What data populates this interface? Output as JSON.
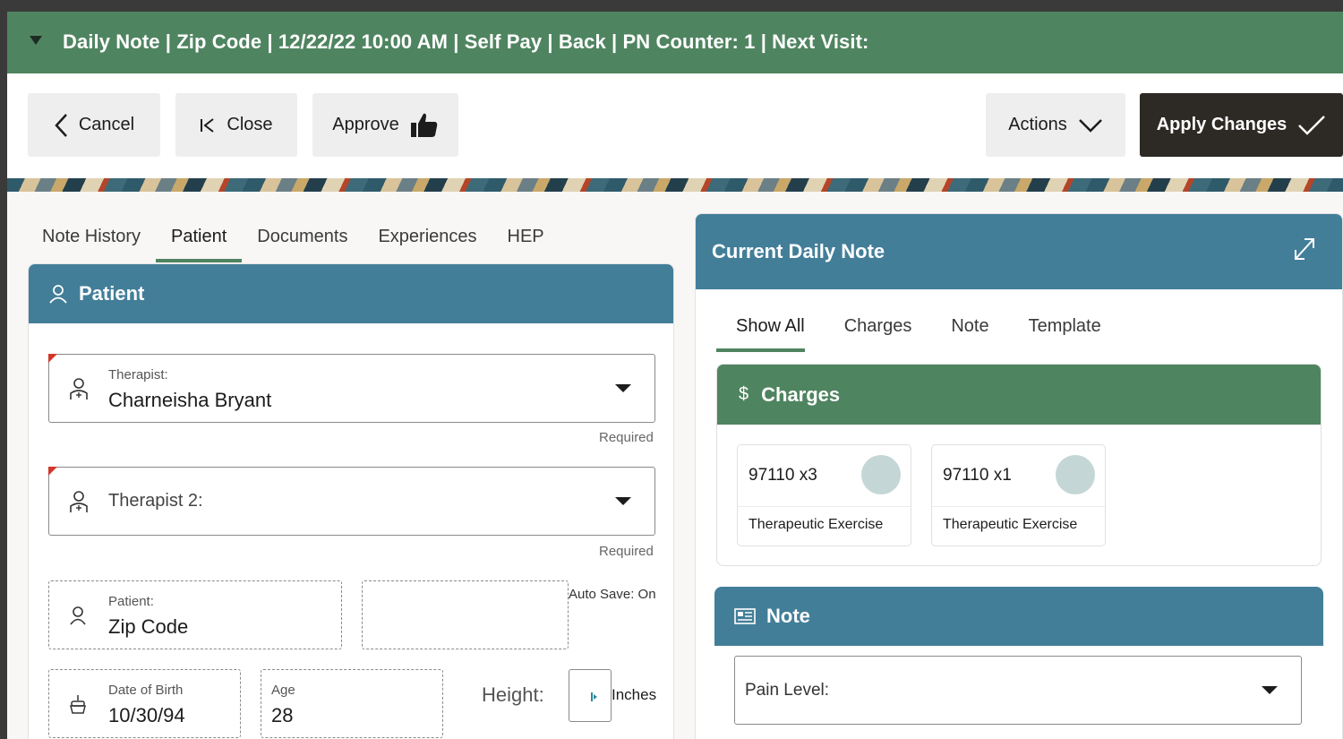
{
  "header": {
    "title": "Daily Note | Zip Code | 12/22/22 10:00 AM | Self Pay | Back | PN Counter: 1 | Next Visit:"
  },
  "toolbar": {
    "cancel_label": "Cancel",
    "close_label": "Close",
    "approve_label": "Approve",
    "actions_label": "Actions",
    "apply_label": "Apply Changes"
  },
  "left_tabs": [
    "Note History",
    "Patient",
    "Documents",
    "Experiences",
    "HEP"
  ],
  "patient_card": {
    "title": "Patient",
    "therapist": {
      "label": "Therapist:",
      "value": "Charneisha Bryant",
      "hint": "Required"
    },
    "therapist2": {
      "label": "Therapist 2:",
      "hint": "Required"
    },
    "patient": {
      "label": "Patient:",
      "value": "Zip Code"
    },
    "auto_save": "Auto Save: On",
    "dob": {
      "label": "Date of Birth",
      "value": "10/30/94"
    },
    "age": {
      "label": "Age",
      "value": "28"
    },
    "height": {
      "label": "Height:",
      "unit": "Inches"
    }
  },
  "right_panel": {
    "title": "Current Daily Note",
    "tabs": [
      "Show All",
      "Charges",
      "Note",
      "Template"
    ],
    "charges_title": "Charges",
    "charges": [
      {
        "code": "97110 x3",
        "description": "Therapeutic Exercise"
      },
      {
        "code": "97110 x1",
        "description": "Therapeutic Exercise"
      }
    ],
    "note_title": "Note",
    "pain_level_label": "Pain Level:"
  },
  "colors": {
    "header_green": "#4f8460",
    "card_blue": "#437e99",
    "apply_dark": "#2d2924",
    "required_flag": "#d3362b"
  }
}
